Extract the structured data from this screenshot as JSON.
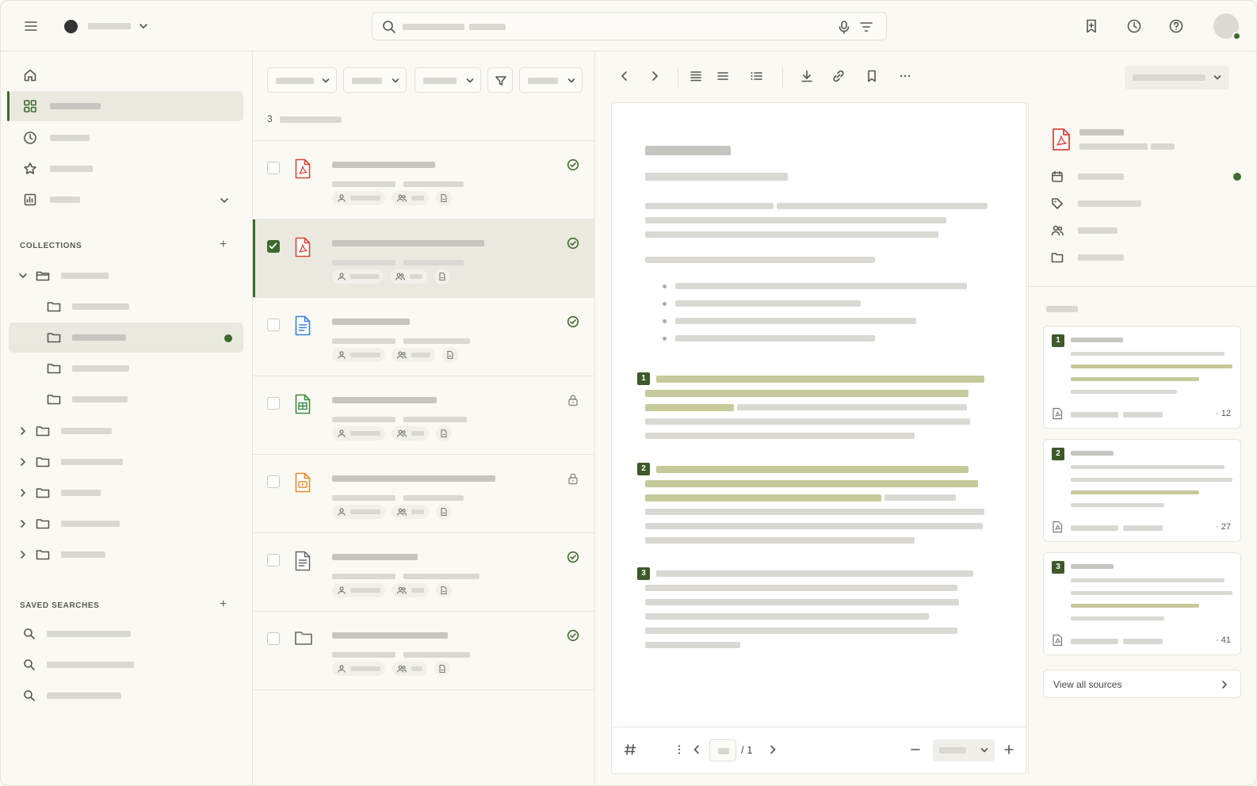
{
  "sidebar": {
    "collections_label": "COLLECTIONS",
    "saved_searches_label": "SAVED SEARCHES",
    "add_symbol": "+"
  },
  "list": {
    "result_count": "3"
  },
  "viewer": {
    "page_total": "/ 1",
    "citations": [
      "1",
      "2",
      "3"
    ]
  },
  "sources": {
    "cards": [
      {
        "label": "1",
        "page": "· 12"
      },
      {
        "label": "2",
        "page": "· 27"
      },
      {
        "label": "3",
        "page": "· 41"
      }
    ],
    "view_all_label": "View all sources"
  },
  "colors": {
    "accent": "#3d6a2e",
    "highlight": "#c6c99a",
    "pdf": "#d9453b",
    "doc": "#3a7fd0",
    "sheet": "#3d8a3a",
    "slides": "#e88a2e"
  },
  "icons": {
    "top": [
      "menu-icon",
      "search-icon",
      "mic-icon",
      "filter-icon",
      "bookmark-icon",
      "history-icon",
      "help-icon"
    ],
    "files": [
      "pdf-icon",
      "pdf-icon",
      "doc-icon",
      "sheet-icon",
      "slides-icon",
      "text-file-icon",
      "folder-icon"
    ]
  }
}
